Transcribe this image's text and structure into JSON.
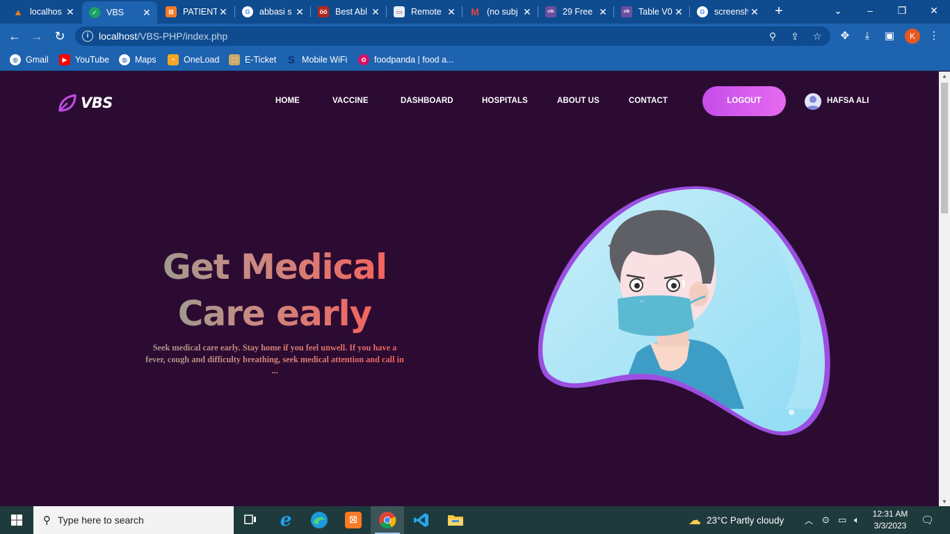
{
  "browser": {
    "tabs": [
      {
        "title": "localhos",
        "favicon": "xampp-orange",
        "color": "#e97c1e"
      },
      {
        "title": "VBS",
        "favicon": "green-check-icon",
        "color": "#1aa260",
        "active": true
      },
      {
        "title": "PATIENT",
        "favicon": "xampp-icon",
        "color": "#fb7a24"
      },
      {
        "title": "abbasi s",
        "favicon": "google-icon",
        "color": "#ffffff"
      },
      {
        "title": "Best Abl",
        "favicon": "site-icon",
        "color": "#b3261e"
      },
      {
        "title": "Remote",
        "favicon": "site-icon",
        "color": "#ffffff"
      },
      {
        "title": "(no subj",
        "favicon": "gmail-icon",
        "color": "#ffffff"
      },
      {
        "title": "29 Free",
        "favicon": "colorlib-icon",
        "color": "#6b4fa0"
      },
      {
        "title": "Table V0",
        "favicon": "colorlib-icon",
        "color": "#6b4fa0"
      },
      {
        "title": "screensh",
        "favicon": "google-icon",
        "color": "#ffffff"
      }
    ],
    "url_host": "localhost",
    "url_path": "/VBS-PHP/index.php",
    "profile_initial": "K",
    "bookmarks": [
      {
        "label": "Gmail",
        "icon": "globe-icon"
      },
      {
        "label": "YouTube",
        "icon": "youtube-icon"
      },
      {
        "label": "Maps",
        "icon": "globe-icon"
      },
      {
        "label": "OneLoad",
        "icon": "oneload-icon"
      },
      {
        "label": "E-Ticket",
        "icon": "eticket-icon"
      },
      {
        "label": "Mobile WiFi",
        "icon": "wifi-icon"
      },
      {
        "label": "foodpanda | food a...",
        "icon": "foodpanda-icon"
      }
    ]
  },
  "site": {
    "logo": "VBS",
    "nav": [
      "HOME",
      "VACCINE",
      "DASHBOARD",
      "HOSPITALS",
      "ABOUT US",
      "CONTACT"
    ],
    "logout": "LOGOUT",
    "user": "HAFSA ALI",
    "hero_line1": "Get Medical",
    "hero_line2": "Care early",
    "hero_text": "Seek medical care early. Stay home if you feel unwell. If you have a fever, cough and difficulty breathing, seek medical attention and call in ...",
    "accent": "#c54dea",
    "background": "#2c0b33"
  },
  "taskbar": {
    "search_placeholder": "Type here to search",
    "weather": "23°C  Partly cloudy",
    "time": "12:31 AM",
    "date": "3/3/2023"
  }
}
